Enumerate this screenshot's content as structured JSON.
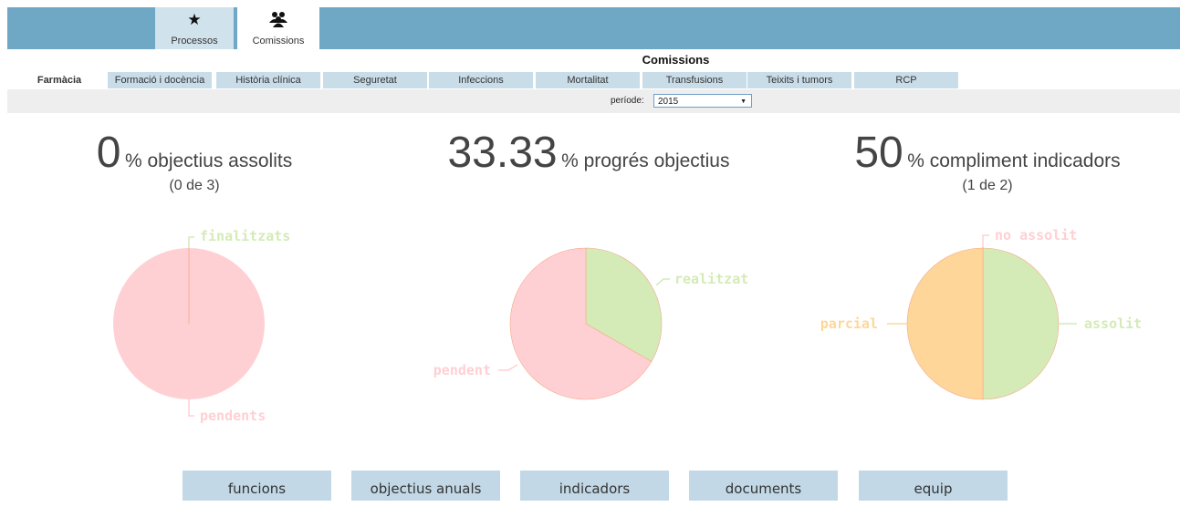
{
  "top_tabs": [
    {
      "label": "Processos",
      "icon": "star-icon"
    },
    {
      "label": "Comissions",
      "icon": "users-icon"
    }
  ],
  "section_title": "Comissions",
  "sub_tabs": [
    "Farmàcia",
    "Formació i docència",
    "Història clínica",
    "Seguretat",
    "Infeccions",
    "Mortalitat",
    "Transfusions",
    "Teixits i tumors",
    "RCP"
  ],
  "active_sub_tab": "Farmàcia",
  "period": {
    "label": "període:",
    "value": "2015"
  },
  "stats": [
    {
      "value": "0",
      "text": "% objectius assolits",
      "sub": "(0 de 3)"
    },
    {
      "value": "33.33",
      "text": "% progrés objectius",
      "sub": ""
    },
    {
      "value": "50",
      "text": "% compliment indicadors",
      "sub": "(1 de 2)"
    }
  ],
  "colors": {
    "green": "#d4ebb7",
    "pink": "#ffd0d3",
    "orange": "#ffd699",
    "topbar": "#6fa8c4"
  },
  "chart_data": [
    {
      "type": "pie",
      "slices": [
        {
          "label": "finalitzats",
          "value": 0,
          "color": "#d4ebb7"
        },
        {
          "label": "pendents",
          "value": 3,
          "color": "#ffd0d3"
        }
      ]
    },
    {
      "type": "pie",
      "slices": [
        {
          "label": "realitzat",
          "value": 33.33,
          "color": "#d4ebb7"
        },
        {
          "label": "pendent",
          "value": 66.67,
          "color": "#ffd0d3"
        }
      ]
    },
    {
      "type": "pie",
      "slices": [
        {
          "label": "no assolit",
          "value": 0,
          "color": "#ffd0d3"
        },
        {
          "label": "assolit",
          "value": 1,
          "color": "#d4ebb7"
        },
        {
          "label": "parcial",
          "value": 1,
          "color": "#ffd699"
        }
      ]
    }
  ],
  "bottom_buttons": [
    "funcions",
    "objectius anuals",
    "indicadors",
    "documents",
    "equip"
  ]
}
